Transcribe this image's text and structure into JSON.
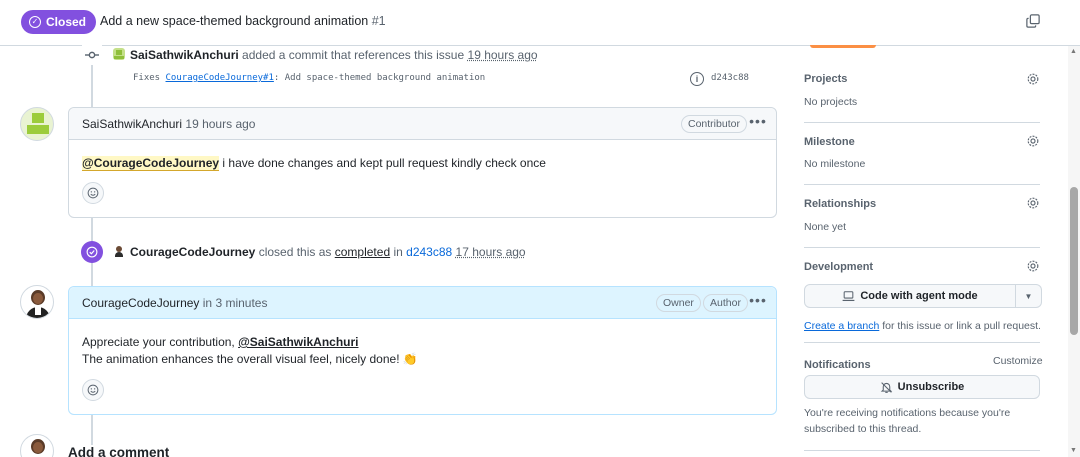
{
  "header": {
    "status_label": "Closed",
    "title": "Add a new space-themed background animation",
    "number": "#1"
  },
  "commit_event": {
    "user": "SaiSathwikAnchuri",
    "action": "added a commit that references this issue",
    "time": "19 hours ago",
    "message_prefix": "Fixes",
    "message_link": "CourageCodeJourney#1",
    "message_rest": ": Add space-themed background animation",
    "sha": "d243c88"
  },
  "comment1": {
    "author": "SaiSathwikAnchuri",
    "time": "19 hours ago",
    "role": "Contributor",
    "mention": "@CourageCodeJourney",
    "body": " i have done changes and kept pull request kindly check once"
  },
  "closed_event": {
    "user": "CourageCodeJourney",
    "action": "closed this as",
    "state": "completed",
    "in": "in",
    "sha": "d243c88",
    "time": "17 hours ago"
  },
  "comment2": {
    "author": "CourageCodeJourney",
    "time_prefix": "in",
    "time": "3 minutes",
    "badge_owner": "Owner",
    "badge_author": "Author",
    "line1_text": "Appreciate your contribution, ",
    "line1_mention": "@SaiSathwikAnchuri",
    "line2": "The animation enhances the overall visual feel, nicely done! 👏"
  },
  "add_comment": {
    "title": "Add a comment"
  },
  "sidebar": {
    "projects": {
      "label": "Projects",
      "value": "No projects"
    },
    "milestone": {
      "label": "Milestone",
      "value": "No milestone"
    },
    "relationships": {
      "label": "Relationships",
      "value": "None yet"
    },
    "development": {
      "label": "Development",
      "button": "Code with agent mode",
      "link": "Create a branch",
      "link_rest": " for this issue or link a pull request."
    },
    "notifications": {
      "label": "Notifications",
      "customize": "Customize",
      "button": "Unsubscribe",
      "note_line1": "You're receiving notifications because you're",
      "note_line2": "subscribed to this thread."
    }
  },
  "colors": {
    "closed_purple": "#8250df",
    "link_blue": "#0969da",
    "owner_comment_bg": "#ddf4ff"
  }
}
